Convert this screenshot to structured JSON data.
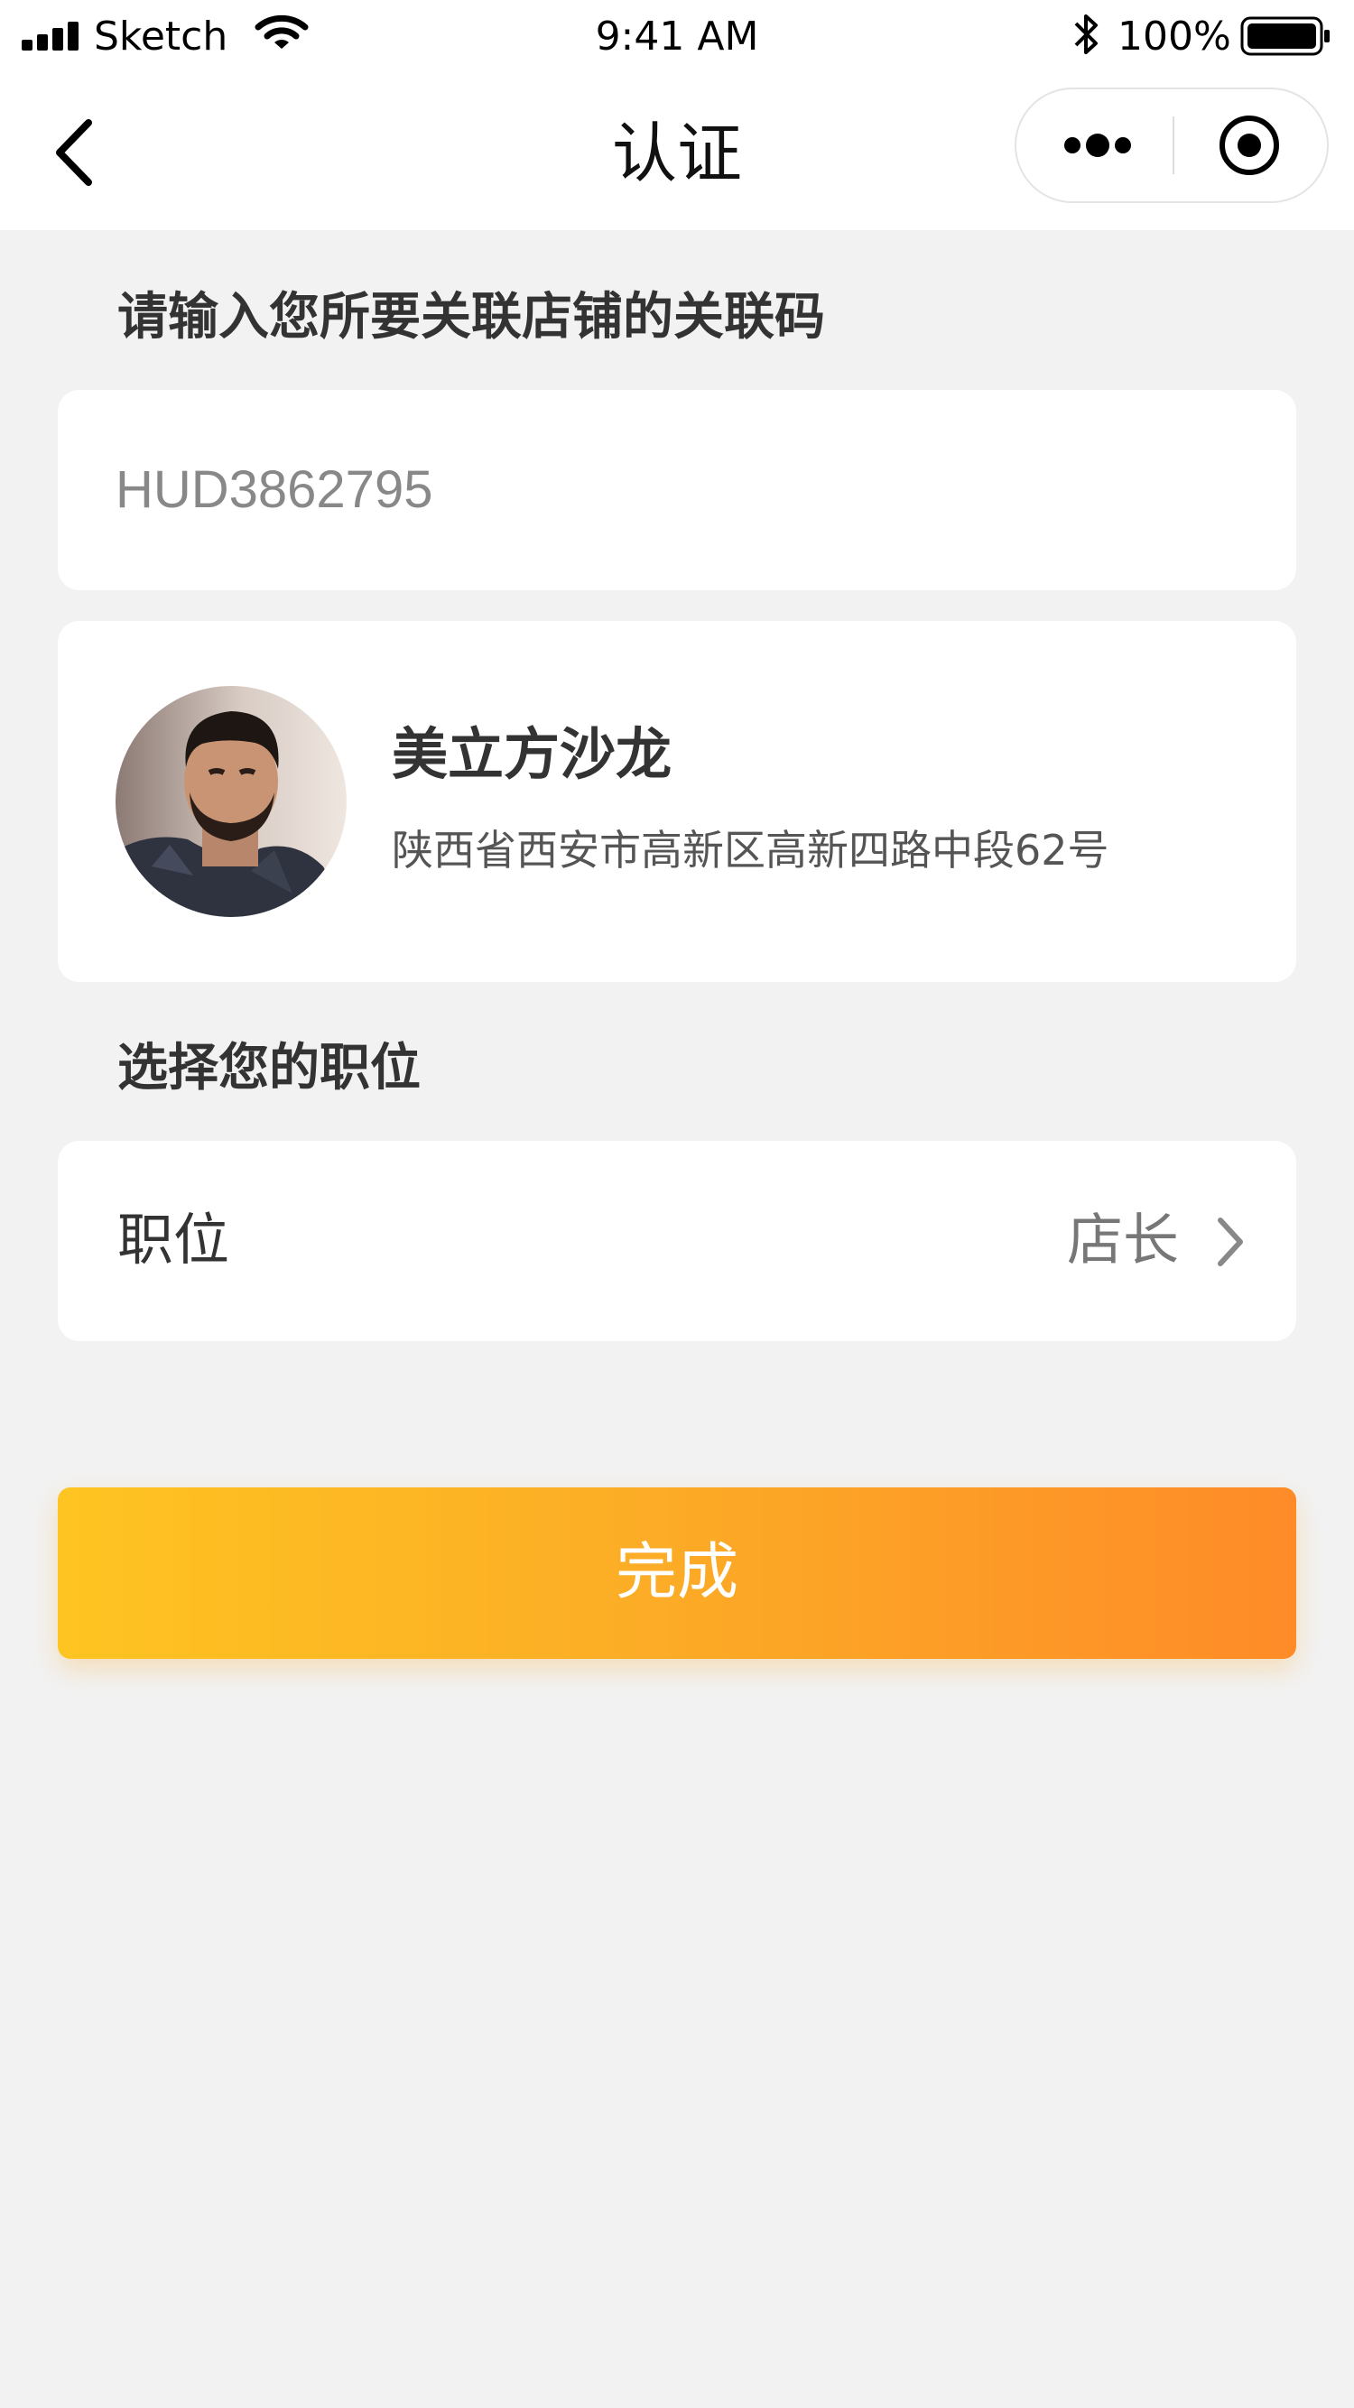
{
  "status_bar": {
    "carrier": "Sketch",
    "time": "9:41 AM",
    "battery_percent": "100%",
    "icons": [
      "signal-bars-icon",
      "wifi-icon",
      "bluetooth-icon",
      "battery-icon"
    ]
  },
  "nav_bar": {
    "title": "认证",
    "back_icon": "chevron-left-icon",
    "capsule_icons": [
      "more-dots-icon",
      "close-miniprogram-icon"
    ]
  },
  "code_section": {
    "title": "请输入您所要关联店铺的关联码",
    "input_value": "HUD3862795"
  },
  "store": {
    "name": "美立方沙龙",
    "address": "陕西省西安市高新区高新四路中段62号",
    "avatar": "store-avatar-photo"
  },
  "position_section": {
    "title": "选择您的职位",
    "label": "职位",
    "value": "店长",
    "chevron_icon": "chevron-right-icon"
  },
  "done_button": {
    "label": "完成"
  },
  "colors": {
    "page_background": "#f2f2f2",
    "card_background": "#ffffff",
    "button_gradient_start": "#fec421",
    "button_gradient_end": "#fe8b28",
    "text_primary": "#333333",
    "text_secondary": "#777777"
  }
}
